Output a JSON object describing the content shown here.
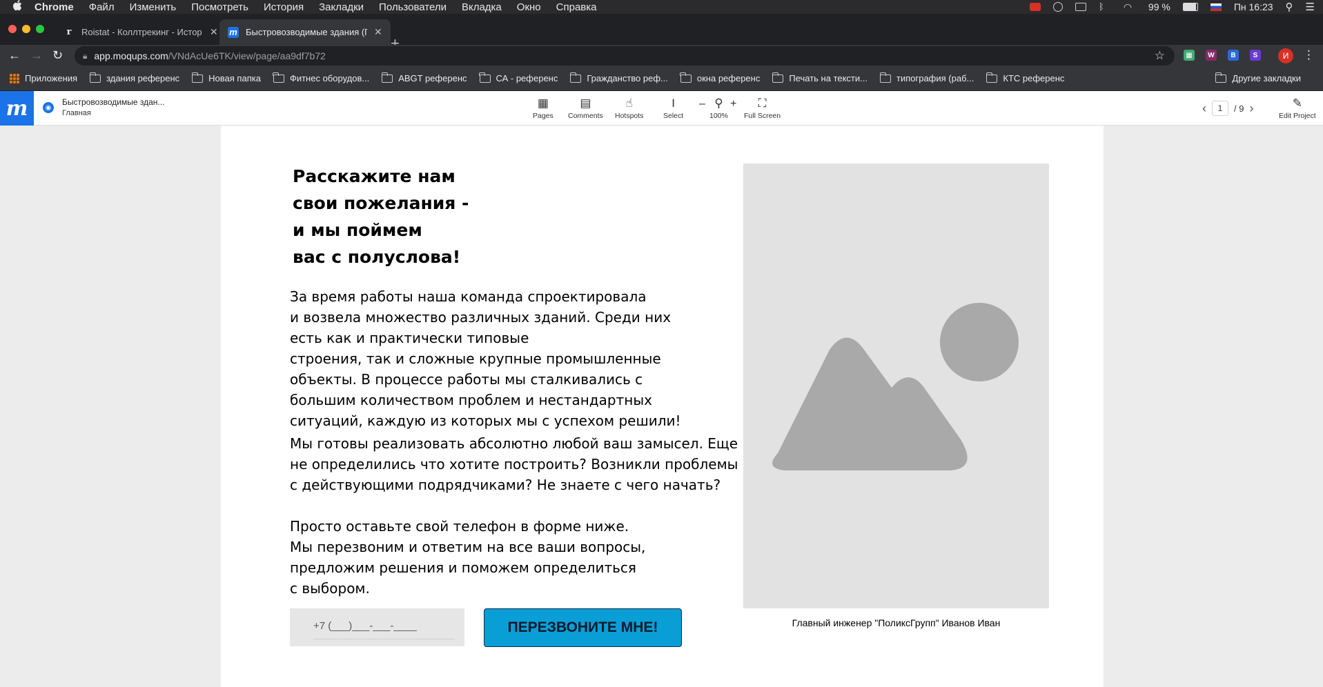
{
  "os_menu": {
    "apple": "",
    "app": "Chrome",
    "items": [
      "Файл",
      "Изменить",
      "Посмотреть",
      "История",
      "Закладки",
      "Пользователи",
      "Вкладка",
      "Окно",
      "Справка"
    ],
    "battery": "99 %",
    "clock": "Пн 16:23"
  },
  "tabs": [
    {
      "favicon": "r",
      "title": "Roistat - Коллтрекинг - Истор",
      "active": false
    },
    {
      "favicon": "m",
      "title": "Быстровозводимые здания (Г",
      "active": true
    }
  ],
  "address": {
    "host": "app.moqups.com",
    "path": "/VNdAcUe6TK/view/page/aa9df7b72"
  },
  "extensions": [
    {
      "label": "▦",
      "color": "#4a7"
    },
    {
      "label": "W",
      "color": "#8a2a6a"
    },
    {
      "label": "B",
      "color": "#2a6ad8"
    },
    {
      "label": "S",
      "color": "#6a3ad8"
    }
  ],
  "profile_initial": "И",
  "bookmarks": {
    "apps": "Приложения",
    "items": [
      "здания референс",
      "Новая папка",
      "Фитнес оборудов...",
      "ABGT референс",
      "СА - референс",
      "Гражданство реф...",
      "окна референс",
      "Печать на тексти...",
      "типография (раб...",
      "КТС референс"
    ],
    "other": "Другие закладки"
  },
  "moqups": {
    "project": "Быстровозводимые здан...",
    "page": "Главная",
    "tools": [
      {
        "icon": "pages-icon",
        "glyph": "▦",
        "label": "Pages"
      },
      {
        "icon": "comments-icon",
        "glyph": "▤",
        "label": "Comments"
      },
      {
        "icon": "hotspots-icon",
        "glyph": "☝",
        "label": "Hotspots"
      },
      {
        "icon": "select-icon",
        "glyph": "I",
        "label": "Select"
      },
      {
        "icon": "zoom-icon",
        "glyph": "⚲",
        "label": "100%"
      },
      {
        "icon": "fullscreen-icon",
        "glyph": "⛶",
        "label": "Full Screen"
      }
    ],
    "zoom_minus": "–",
    "zoom_plus": "+",
    "pager": {
      "current": "1",
      "total": "/ 9"
    },
    "edit_label": "Edit Project"
  },
  "content": {
    "heading": [
      "Расскажите нам",
      "свои пожелания -",
      "и мы поймем",
      "вас с полуслова!"
    ],
    "para1": [
      "За время работы наша команда спроектировала",
      "и возвела множество различных зданий. Среди них",
      "есть как и практически типовые",
      "строения, так и сложные крупные промышленные",
      "объекты. В процессе работы мы сталкивались с",
      "большим количеством проблем и нестандартных",
      "ситуаций, каждую из которых мы с успехом решили!"
    ],
    "para2": [
      "Мы готовы реализовать абсолютно любой ваш замысел. Еще",
      "не определились что хотите построить? Возникли проблемы",
      "с действующими подрядчиками? Не знаете с чего начать?"
    ],
    "para3": [
      "Просто оставьте свой телефон в форме ниже.",
      "Мы перезвоним и ответим на все ваши вопросы,",
      "предложим решения и поможем определиться",
      "с выбором."
    ],
    "phone_placeholder": "+7 (___)___-___-____",
    "cta": "ПЕРЕЗВОНИТЕ МНЕ!",
    "caption": "Главный инженер \"ПоликсГрупп\" Иванов Иван"
  },
  "colors": {
    "cta_bg": "#0a9ed6",
    "moqups_brand": "#1a73e8",
    "placeholder_bg": "#e2e2e2",
    "placeholder_shape": "#a9a9a9"
  }
}
